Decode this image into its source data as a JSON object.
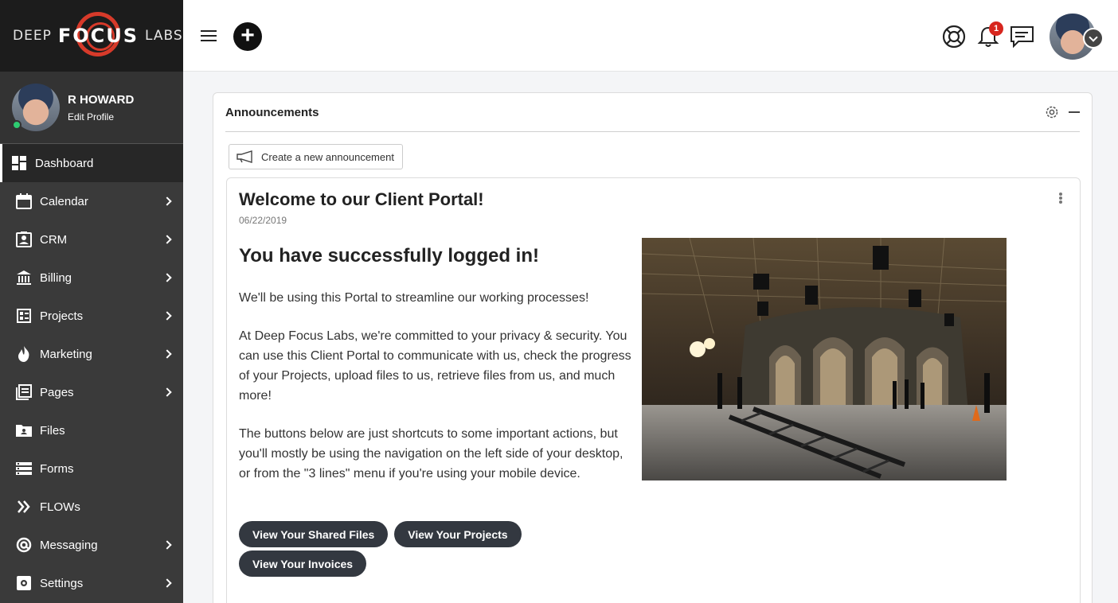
{
  "brand": {
    "deep": "DEEP",
    "focus": "FOCUS",
    "labs": "LABS",
    "accent": "#d73a2a"
  },
  "profile": {
    "name": "R HOWARD",
    "edit_label": "Edit Profile",
    "status": "online"
  },
  "sidebar": {
    "items": [
      {
        "label": "Dashboard",
        "icon": "dashboard-icon",
        "active": true,
        "has_children": false
      },
      {
        "label": "Calendar",
        "icon": "calendar-icon",
        "has_children": true
      },
      {
        "label": "CRM",
        "icon": "contact-card-icon",
        "has_children": true
      },
      {
        "label": "Billing",
        "icon": "bank-icon",
        "has_children": true
      },
      {
        "label": "Projects",
        "icon": "project-list-icon",
        "has_children": true
      },
      {
        "label": "Marketing",
        "icon": "flame-icon",
        "has_children": true
      },
      {
        "label": "Pages",
        "icon": "pages-icon",
        "has_children": true
      },
      {
        "label": "Files",
        "icon": "folder-icon",
        "has_children": false
      },
      {
        "label": "Forms",
        "icon": "forms-icon",
        "has_children": false
      },
      {
        "label": "FLOWs",
        "icon": "double-chevron-icon",
        "has_children": false
      },
      {
        "label": "Messaging",
        "icon": "at-sign-icon",
        "has_children": true
      },
      {
        "label": "Settings",
        "icon": "settings-icon",
        "has_children": true
      }
    ]
  },
  "topbar": {
    "notification_count": "1"
  },
  "announcements": {
    "title": "Announcements",
    "create_label": "Create a new announcement",
    "post": {
      "title": "Welcome to our Client Portal!",
      "date": "06/22/2019",
      "heading": "You have successfully logged in!",
      "paragraphs": [
        "We'll be using this Portal to streamline our working processes!",
        "At Deep Focus Labs, we're committed to your privacy & security. You can use this Client Portal to communicate with us, check the progress of your Projects, upload files to us, retrieve files from us, and much more!",
        "The buttons below are just shortcuts to some important actions, but you'll mostly be using the navigation on the left side of your desktop, or from the \"3 lines\" menu if you're using your mobile device."
      ],
      "buttons": [
        "View Your Shared Files",
        "View Your Projects",
        "View Your Invoices"
      ]
    }
  }
}
